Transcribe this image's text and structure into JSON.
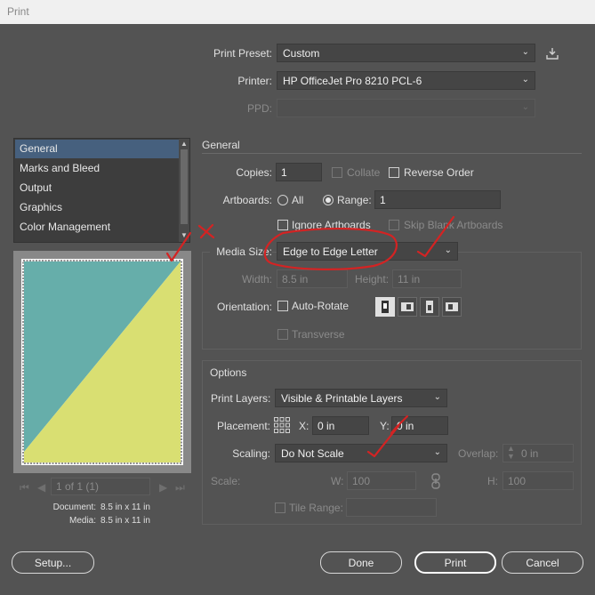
{
  "window": {
    "title": "Print"
  },
  "top": {
    "print_preset": {
      "label": "Print Preset:",
      "value": "Custom"
    },
    "printer": {
      "label": "Printer:",
      "value": "HP OfficeJet Pro 8210 PCL-6"
    },
    "ppd": {
      "label": "PPD:",
      "value": ""
    }
  },
  "sidebar": {
    "items": [
      {
        "label": "General"
      },
      {
        "label": "Marks and Bleed"
      },
      {
        "label": "Output"
      },
      {
        "label": "Graphics"
      },
      {
        "label": "Color Management"
      }
    ],
    "selected": "General"
  },
  "general": {
    "section_title": "General",
    "copies": {
      "label": "Copies:",
      "value": "1"
    },
    "collate": {
      "label": "Collate",
      "checked": false
    },
    "reverse_order": {
      "label": "Reverse Order",
      "checked": false
    },
    "artboards": {
      "label": "Artboards:",
      "all_label": "All",
      "range_label": "Range:",
      "range_value": "1",
      "selected": "Range"
    },
    "ignore_artboards": {
      "label": "Ignore Artboards",
      "checked": false
    },
    "skip_blank": {
      "label": "Skip Blank Artboards",
      "checked": false
    },
    "media_size": {
      "label": "Media Size:",
      "value": "Edge to Edge Letter"
    },
    "width": {
      "label": "Width:",
      "value": "8.5 in"
    },
    "height": {
      "label": "Height:",
      "value": "11 in"
    },
    "orientation": {
      "label": "Orientation:",
      "auto_rotate_label": "Auto-Rotate",
      "auto_rotate_checked": false,
      "selected_index": 0
    },
    "transverse": {
      "label": "Transverse",
      "checked": false
    }
  },
  "options": {
    "section_title": "Options",
    "print_layers": {
      "label": "Print Layers:",
      "value": "Visible & Printable Layers"
    },
    "placement": {
      "label": "Placement:",
      "x_label": "X:",
      "x_value": "0 in",
      "y_label": "Y:",
      "y_value": "0 in"
    },
    "scaling": {
      "label": "Scaling:",
      "value": "Do Not Scale"
    },
    "overlap": {
      "label": "Overlap:",
      "value": "0 in"
    },
    "scale": {
      "label": "Scale:",
      "w_label": "W:",
      "w_value": "100",
      "h_label": "H:",
      "h_value": "100"
    },
    "tile_range": {
      "label": "Tile Range:",
      "value": ""
    }
  },
  "preview": {
    "pager_text": "1 of 1 (1)",
    "document_label": "Document:",
    "document_value": "8.5 in x 11 in",
    "media_label": "Media:",
    "media_value": "8.5 in x 11 in",
    "colors": {
      "teal": "#66aeaa",
      "yellow": "#d9df72"
    }
  },
  "buttons": {
    "setup": "Setup...",
    "done": "Done",
    "print": "Print",
    "cancel": "Cancel"
  },
  "annotation_color": "#d42323"
}
